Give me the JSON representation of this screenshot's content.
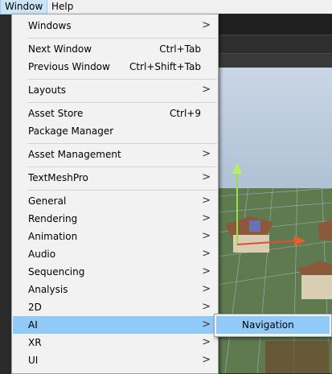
{
  "menubar": {
    "items": [
      {
        "label": "Window"
      },
      {
        "label": "Help"
      }
    ]
  },
  "window_menu": {
    "items": [
      {
        "label": "Windows",
        "shortcut": "",
        "submenu": true
      },
      {
        "label": "Next Window",
        "shortcut": "Ctrl+Tab",
        "submenu": false
      },
      {
        "label": "Previous Window",
        "shortcut": "Ctrl+Shift+Tab",
        "submenu": false
      },
      {
        "label": "Layouts",
        "shortcut": "",
        "submenu": true
      },
      {
        "label": "Asset Store",
        "shortcut": "Ctrl+9",
        "submenu": false
      },
      {
        "label": "Package Manager",
        "shortcut": "",
        "submenu": false
      },
      {
        "label": "Asset Management",
        "shortcut": "",
        "submenu": true
      },
      {
        "label": "TextMeshPro",
        "shortcut": "",
        "submenu": true
      },
      {
        "label": "General",
        "shortcut": "",
        "submenu": true
      },
      {
        "label": "Rendering",
        "shortcut": "",
        "submenu": true
      },
      {
        "label": "Animation",
        "shortcut": "",
        "submenu": true
      },
      {
        "label": "Audio",
        "shortcut": "",
        "submenu": true
      },
      {
        "label": "Sequencing",
        "shortcut": "",
        "submenu": true
      },
      {
        "label": "Analysis",
        "shortcut": "",
        "submenu": true
      },
      {
        "label": "2D",
        "shortcut": "",
        "submenu": true
      },
      {
        "label": "AI",
        "shortcut": "",
        "submenu": true,
        "highlighted": true
      },
      {
        "label": "XR",
        "shortcut": "",
        "submenu": true
      },
      {
        "label": "UI",
        "shortcut": "",
        "submenu": true
      }
    ],
    "submenu_arrow": ">"
  },
  "ai_submenu": {
    "items": [
      {
        "label": "Navigation"
      }
    ]
  },
  "colors": {
    "highlight": "#91c9f7",
    "menu_bg": "#f2f2f2",
    "menubar_active": "#cce4f7"
  }
}
